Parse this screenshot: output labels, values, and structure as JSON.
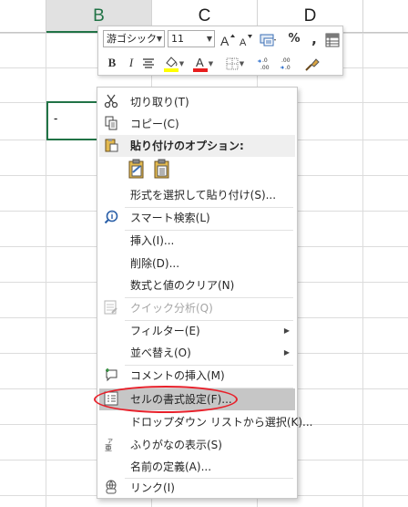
{
  "sheet": {
    "columns": [
      "",
      "B",
      "C",
      "D",
      ""
    ],
    "selected_column": "B",
    "cell_value": "-"
  },
  "mini_toolbar": {
    "font_name": "游ゴシック",
    "font_size": "11",
    "font_color": "#e81e1e",
    "fill_color": "#ffff00"
  },
  "context_menu": {
    "items": [
      {
        "label": "切り取り(T)",
        "icon": "scissors-icon"
      },
      {
        "label": "コピー(C)",
        "icon": "copy-icon"
      },
      {
        "label": "貼り付けのオプション:",
        "icon": "paste-icon"
      },
      {
        "label": "形式を選択して貼り付け(S)...",
        "icon": ""
      },
      {
        "label": "スマート検索(L)",
        "icon": "smart-lookup-icon"
      },
      {
        "label": "挿入(I)...",
        "icon": ""
      },
      {
        "label": "削除(D)...",
        "icon": ""
      },
      {
        "label": "数式と値のクリア(N)",
        "icon": ""
      },
      {
        "label": "クイック分析(Q)",
        "icon": "quick-analysis-icon"
      },
      {
        "label": "フィルター(E)",
        "icon": ""
      },
      {
        "label": "並べ替え(O)",
        "icon": ""
      },
      {
        "label": "コメントの挿入(M)",
        "icon": "comment-icon"
      },
      {
        "label": "セルの書式設定(F)...",
        "icon": "format-cells-icon"
      },
      {
        "label": "ドロップダウン リストから選択(K)...",
        "icon": ""
      },
      {
        "label": "ふりがなの表示(S)",
        "icon": "furigana-icon"
      },
      {
        "label": "名前の定義(A)...",
        "icon": ""
      },
      {
        "label": "リンク(I)",
        "icon": "link-icon"
      }
    ],
    "highlighted_color": "#c6c6c6",
    "annotation_color": "#e8202a"
  }
}
